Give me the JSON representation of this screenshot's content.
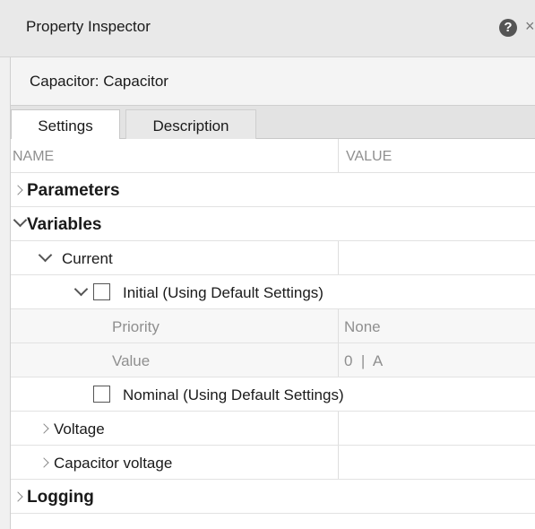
{
  "header": {
    "title": "Property Inspector",
    "help_icon": "question-mark-circle-icon",
    "close_icon": "close-icon"
  },
  "context": {
    "label": "Capacitor: Capacitor"
  },
  "tabs": [
    {
      "label": "Settings",
      "active": true
    },
    {
      "label": "Description",
      "active": false
    }
  ],
  "table": {
    "columns": {
      "name": "NAME",
      "value": "VALUE"
    },
    "rows": {
      "parameters": {
        "label": "Parameters",
        "expanded": false
      },
      "variables": {
        "label": "Variables",
        "expanded": true
      },
      "current": {
        "label": "Current",
        "expanded": true
      },
      "initial": {
        "label": "Initial (Using Default Settings)",
        "checked": false,
        "expanded": true
      },
      "priority": {
        "label": "Priority",
        "value": "None"
      },
      "value": {
        "label": "Value",
        "value": "0  |  A"
      },
      "nominal": {
        "label": "Nominal (Using Default Settings)",
        "checked": false
      },
      "voltage": {
        "label": "Voltage",
        "expanded": false
      },
      "capacitor_voltage": {
        "label": "Capacitor voltage",
        "expanded": false
      },
      "logging": {
        "label": "Logging",
        "expanded": false
      }
    }
  }
}
